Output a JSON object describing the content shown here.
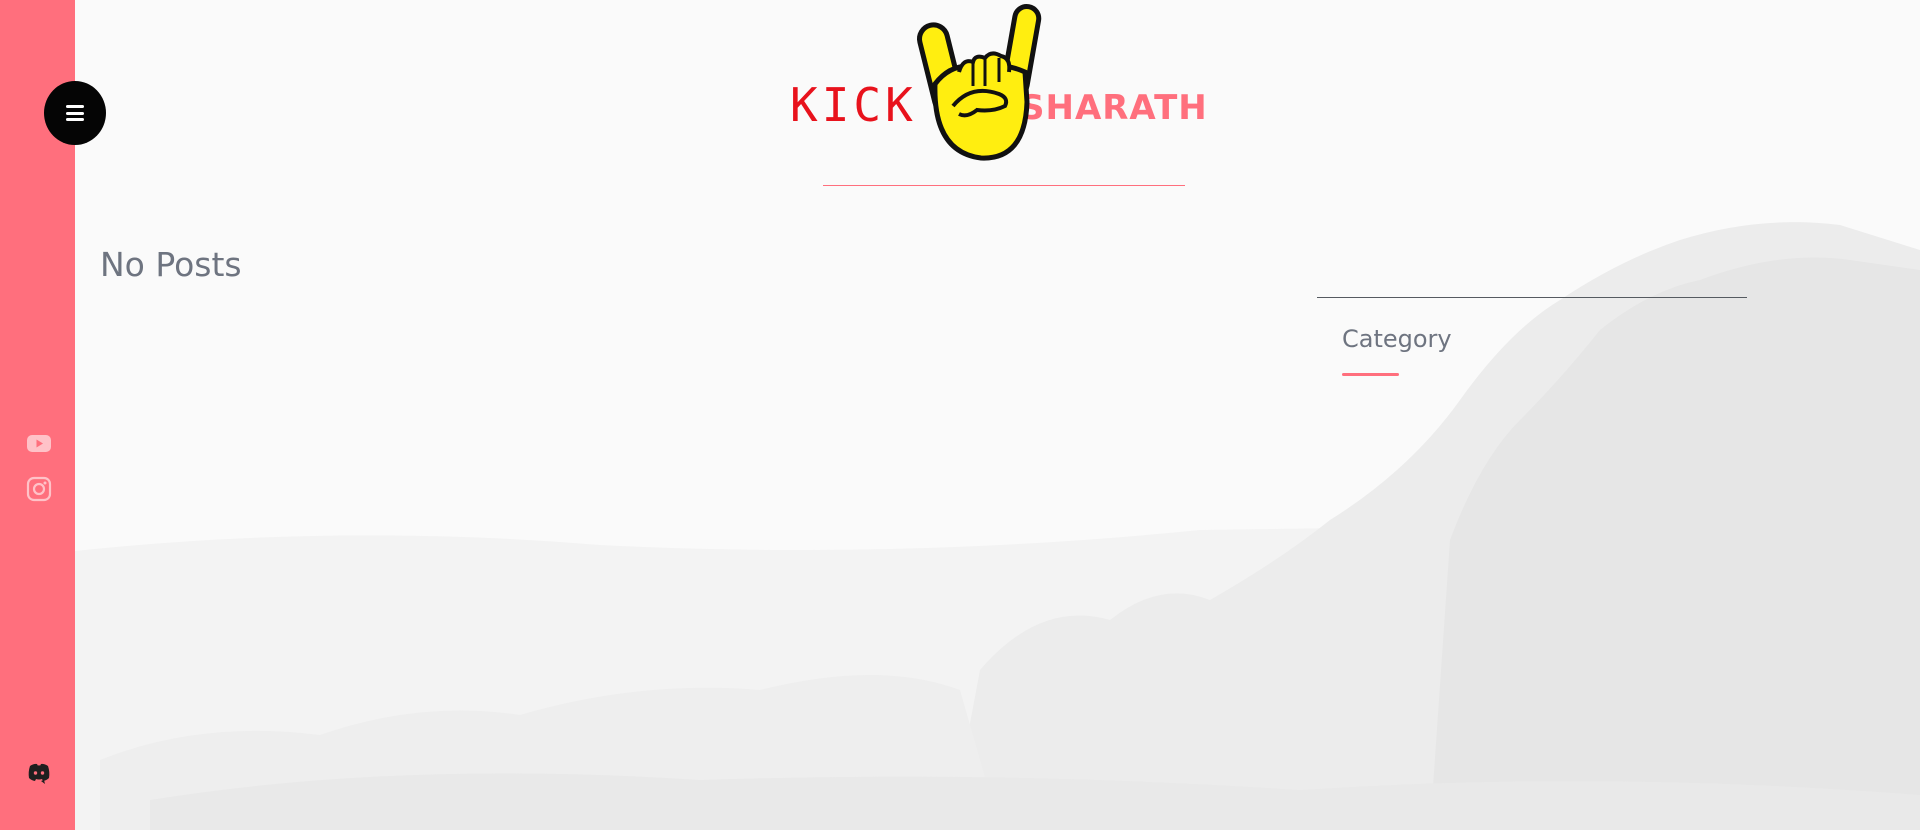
{
  "colors": {
    "accent": "#ff6f7d",
    "menu_button": "#050505",
    "heading_text": "#6e7480",
    "logo_red": "#e8121c",
    "hand_yellow": "#ffee10"
  },
  "sidebar": {
    "menu_icon": "hamburger-menu-icon",
    "social": [
      {
        "icon": "youtube-icon"
      },
      {
        "icon": "instagram-icon"
      },
      {
        "icon": "discord-icon"
      }
    ]
  },
  "logo": {
    "word_left": "KICK",
    "word_right": "SHARATH",
    "icon": "rock-hand-icon"
  },
  "main": {
    "status_text": "No Posts"
  },
  "widget": {
    "title": "Category"
  }
}
